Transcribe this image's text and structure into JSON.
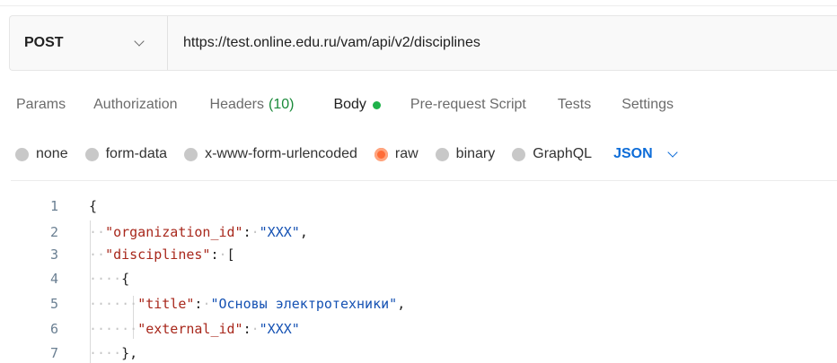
{
  "request": {
    "method": "POST",
    "url": "https://test.online.edu.ru/vam/api/v2/disciplines"
  },
  "tabs": [
    {
      "label": "Params"
    },
    {
      "label": "Authorization"
    },
    {
      "label": "Headers",
      "count": "(10)"
    },
    {
      "label": "Body"
    },
    {
      "label": "Pre-request Script"
    },
    {
      "label": "Tests"
    },
    {
      "label": "Settings"
    }
  ],
  "body_options": {
    "items": [
      "none",
      "form-data",
      "x-www-form-urlencoded",
      "raw",
      "binary",
      "GraphQL"
    ],
    "selected": "raw",
    "language": "JSON"
  },
  "editor": {
    "lines": [
      {
        "num": "1"
      },
      {
        "num": "2",
        "key": "\"organization_id\"",
        "value": "\"XXX\""
      },
      {
        "num": "3",
        "key": "\"disciplines\""
      },
      {
        "num": "4"
      },
      {
        "num": "5",
        "key": "\"title\"",
        "value": "\"Основы электротехники\""
      },
      {
        "num": "6",
        "key": "\"external_id\"",
        "value": "\"XXX\""
      },
      {
        "num": "7"
      }
    ]
  },
  "colors": {
    "accent_orange": "#ff6c37",
    "active_dot": "#1fb24a",
    "json_blue": "#0e6dd8",
    "json_key": "#a8281c",
    "json_string": "#1451b3"
  }
}
